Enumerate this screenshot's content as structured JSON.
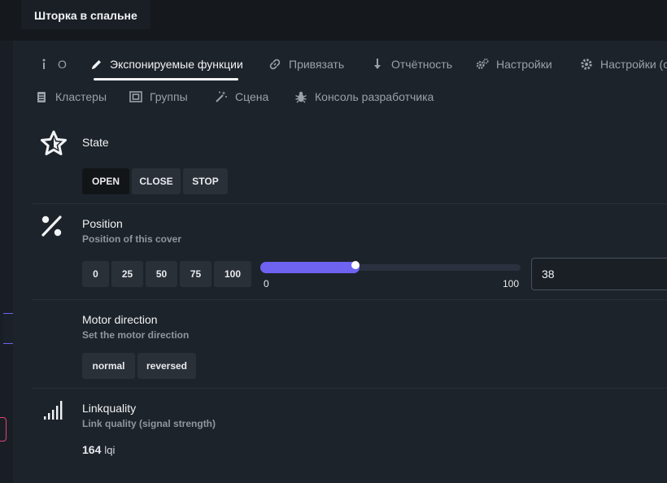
{
  "window": {
    "title": "Шторка в спальне"
  },
  "tabs_row1": [
    {
      "key": "info",
      "label": "О",
      "icon": "info-icon"
    },
    {
      "key": "exposes",
      "label": "Экспонируемые функции",
      "icon": "pencil-icon",
      "active": true
    },
    {
      "key": "bind",
      "label": "Привязать",
      "icon": "link-icon"
    },
    {
      "key": "reporting",
      "label": "Отчётность",
      "icon": "arrow-down-icon"
    },
    {
      "key": "settings",
      "label": "Настройки",
      "icon": "cogs-icon"
    },
    {
      "key": "settings_specific",
      "label": "Настройки (с",
      "icon": "cog-icon"
    }
  ],
  "tabs_row2": [
    {
      "key": "clusters",
      "label": "Кластеры",
      "icon": "clusters-icon"
    },
    {
      "key": "groups",
      "label": "Группы",
      "icon": "groups-icon"
    },
    {
      "key": "scene",
      "label": "Сцена",
      "icon": "magic-wand-icon"
    },
    {
      "key": "dev_console",
      "label": "Консоль разработчика",
      "icon": "bug-icon"
    }
  ],
  "state": {
    "title": "State",
    "icon": "star-icon",
    "buttons": [
      "OPEN",
      "CLOSE",
      "STOP"
    ],
    "active": "OPEN"
  },
  "position": {
    "title": "Position",
    "description": "Position of this cover",
    "icon": "percent-icon",
    "presets": [
      "0",
      "25",
      "50",
      "75",
      "100"
    ],
    "slider_min": "0",
    "slider_max": "100",
    "value": 38,
    "input_value": "38"
  },
  "motor_direction": {
    "title": "Motor direction",
    "description": "Set the motor direction",
    "options": [
      "normal",
      "reversed"
    ]
  },
  "linkquality": {
    "title": "Linkquality",
    "description": "Link quality (signal strength)",
    "icon": "signal-icon",
    "value": "164",
    "unit": "lqi"
  },
  "colors": {
    "accent": "#6d63f0",
    "background": "#15191e",
    "card": "#1d232a",
    "button": "#2a3038",
    "text": "#e8eaed",
    "muted": "#8f969f"
  }
}
